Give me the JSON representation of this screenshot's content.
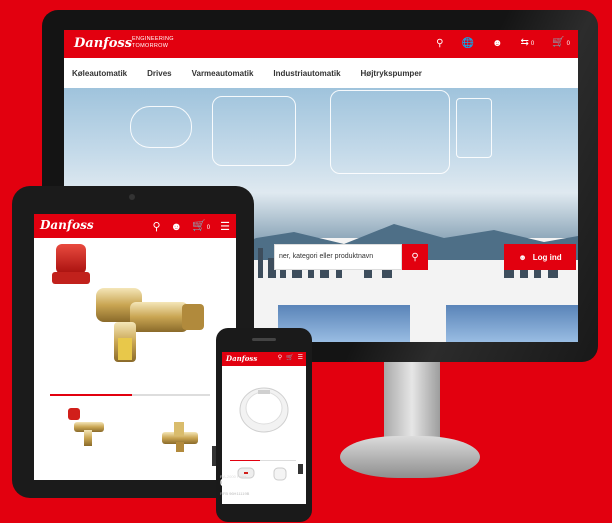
{
  "desktop_site": {
    "brand": "Danfoss",
    "tagline": [
      "ENGINEERING",
      "TOMORROW"
    ],
    "cart_count": "0",
    "compare_count": "0",
    "nav": [
      "Køleautomatik",
      "Drives",
      "Varmeautomatik",
      "Industriautomatik",
      "Højtrykspumper"
    ],
    "search_placeholder": "ner, kategori eller produktnavn",
    "login_label": "Log ind"
  },
  "tablet_site": {
    "brand": "Danfoss",
    "cart_count": "0"
  },
  "phone_site": {
    "brand": "Danfoss",
    "product_subtitle": "RA-2000 Føler",
    "product_code": "013G2990",
    "product_detail": "RFB 96H11119B"
  },
  "icons": [
    "search-icon",
    "globe-icon",
    "user-icon",
    "compare-icon",
    "cart-icon",
    "menu-icon",
    "chevron-right-icon"
  ],
  "colors": {
    "brand_red": "#e2000f",
    "device_black": "#1a1a1a"
  }
}
